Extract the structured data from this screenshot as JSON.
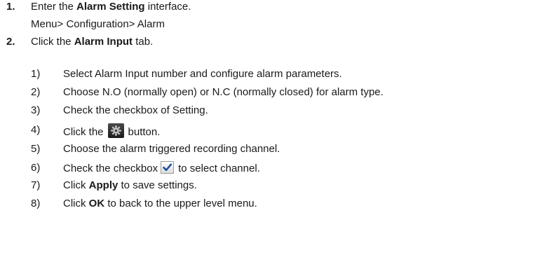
{
  "steps": [
    {
      "num": "1.",
      "pre": "Enter the ",
      "bold": "Alarm Setting",
      "post": " interface.",
      "path": "Menu> Configuration> Alarm"
    },
    {
      "num": "2.",
      "pre": "Click the ",
      "bold": "Alarm Input",
      "post": " tab."
    }
  ],
  "substeps": [
    {
      "num": "1)",
      "text": "Select Alarm Input number and configure alarm parameters."
    },
    {
      "num": "2)",
      "text": "Choose N.O (normally open) or N.C (normally closed) for alarm type."
    },
    {
      "num": "3)",
      "text": "Check the checkbox of Setting."
    },
    {
      "num": "4)",
      "pre": "Click the",
      "post": "button.",
      "icon": "gear-icon"
    },
    {
      "num": "5)",
      "text": "Choose the alarm triggered recording channel."
    },
    {
      "num": "6)",
      "pre": "Check the checkbox",
      "post": "to select channel.",
      "icon": "checkmark-icon"
    },
    {
      "num": "7)",
      "pre": "Click ",
      "bold": "Apply",
      "post": " to save settings."
    },
    {
      "num": "8)",
      "pre": "Click ",
      "bold": "OK",
      "post": " to back to the upper level menu."
    }
  ]
}
